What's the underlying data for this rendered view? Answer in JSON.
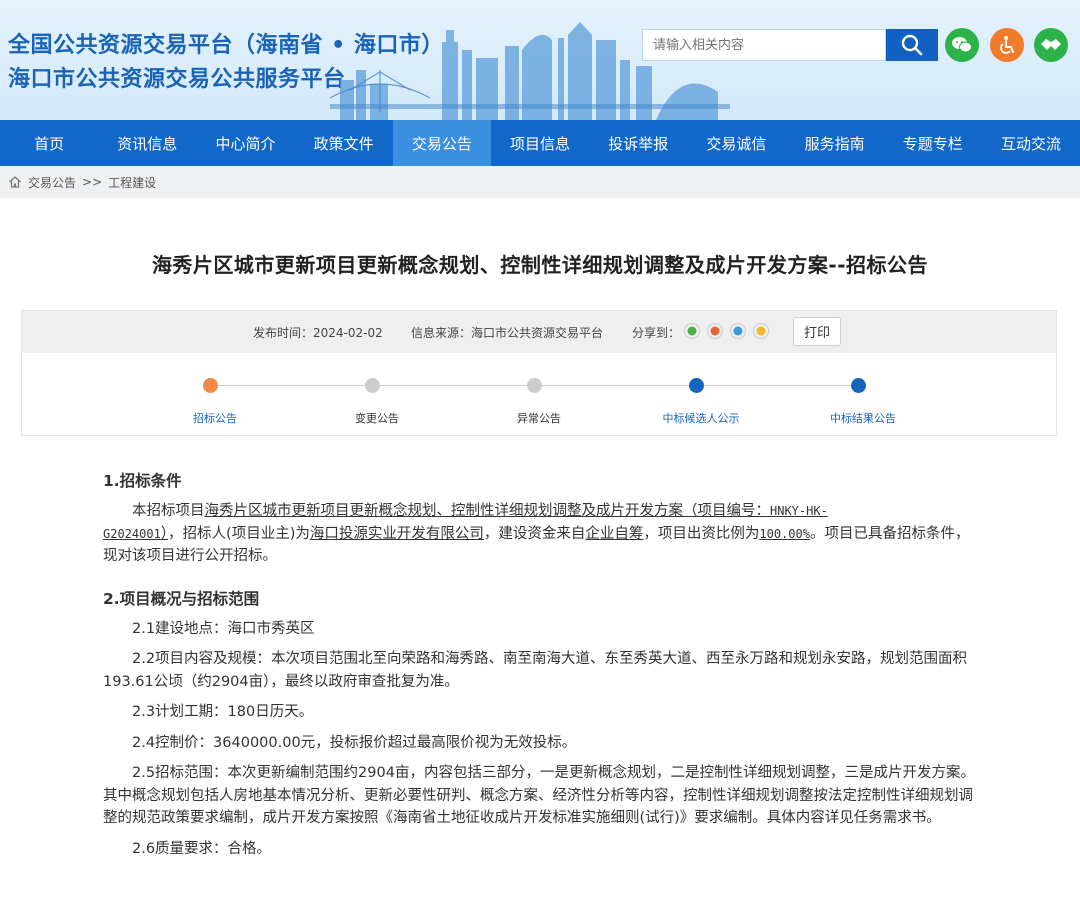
{
  "header": {
    "title_line1": "全国公共资源交易平台（海南省 • 海口市）",
    "title_line2": "海口市公共资源交易公共服务平台",
    "search_placeholder": "请输入相关内容"
  },
  "colors": {
    "brand_blue": "#1268c9",
    "nav_active": "#3b8ee0",
    "step_orange": "#f08a44",
    "step_gray": "#cccccc",
    "step_blue": "#1565c0",
    "wechat_green": "#2bb34a",
    "accessibility_orange": "#f07b2b"
  },
  "nav": {
    "items": [
      "首页",
      "资讯信息",
      "中心简介",
      "政策文件",
      "交易公告",
      "项目信息",
      "投诉举报",
      "交易诚信",
      "服务指南",
      "专题专栏",
      "互动交流"
    ],
    "active_index": 4
  },
  "breadcrumb": {
    "items": [
      "交易公告",
      ">>",
      "工程建设"
    ]
  },
  "article": {
    "title": "海秀片区城市更新项目更新概念规划、控制性详细规划调整及成片开发方案--招标公告",
    "publish_time": "发布时间：2024-02-02",
    "source": "信息来源：海口市公共资源交易平台",
    "share_label": "分享到：",
    "print_label": "打印"
  },
  "steps": [
    {
      "label": "招标公告",
      "state": "current"
    },
    {
      "label": "变更公告",
      "state": "disabled"
    },
    {
      "label": "异常公告",
      "state": "disabled"
    },
    {
      "label": "中标候选人公示",
      "state": "available"
    },
    {
      "label": "中标结果公告",
      "state": "available"
    }
  ],
  "content": {
    "s1_title": "1.招标条件",
    "s1_a": "本招标项目",
    "s1_proj": "海秀片区城市更新项目更新概念规划、控制性详细规划调整及成片开发方案（项目编号：",
    "s1_code1": "HNKY-HK-",
    "s1_code2": "G2024001",
    "s1_close": "）",
    "s1_b": "，招标人(项目业主)为",
    "s1_owner": "海口投源实业开发有限公司",
    "s1_c": "，建设资金来自",
    "s1_fund": "企业自筹",
    "s1_d": "，项目出资比例为",
    "s1_ratio": "100.00%",
    "s1_e": "。项目已具备招标条件，现对该项目进行公开招标。",
    "s2_title": "2.项目概况与招标范围",
    "p21": "2.1建设地点：海口市秀英区",
    "p22": "2.2项目内容及规模：本次项目范围北至向荣路和海秀路、南至南海大道、东至秀英大道、西至永万路和规划永安路，规划范围面积193.61公顷（约2904亩），最终以政府审查批复为准。",
    "p23": "2.3计划工期：180日历天。",
    "p24": "2.4控制价：3640000.00元，投标报价超过最高限价视为无效投标。",
    "p25": "2.5招标范围：本次更新编制范围约2904亩，内容包括三部分，一是更新概念规划，二是控制性详细规划调整，三是成片开发方案。其中概念规划包括人房地基本情况分析、更新必要性研判、概念方案、经济性分析等内容，控制性详细规划调整按法定控制性详细规划调整的规范政策要求编制，成片开发方案按照《海南省土地征收成片开发标准实施细则(试行)》要求编制。具体内容详见任务需求书。",
    "p26": "2.6质量要求：合格。"
  }
}
